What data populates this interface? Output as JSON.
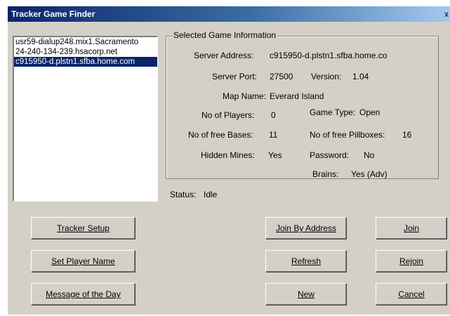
{
  "window": {
    "title": "Tracker Game Finder",
    "close_glyph": "x"
  },
  "servers": [
    "usr59-dialup248.mix1.Sacramento",
    "24-240-134-239.hsacorp.net",
    "c915950-d.plstn1.sfba.home.com"
  ],
  "selected_server_index": 2,
  "info": {
    "legend": "Selected Game Information",
    "server_address_label": "Server Address:",
    "server_address": "c915950-d.plstn1.sfba.home.co",
    "server_port_label": "Server Port:",
    "server_port": "27500",
    "version_label": "Version:",
    "version": "1.04",
    "map_name_label": "Map Name:",
    "map_name": "Everard Island",
    "players_label": "No of Players:",
    "players": "0",
    "game_type_label": "Game Type:",
    "game_type": "Open",
    "bases_label": "No of free Bases:",
    "bases": "11",
    "pillboxes_label": "No of free Pillboxes:",
    "pillboxes": "16",
    "mines_label": "Hidden Mines:",
    "mines": "Yes",
    "password_label": "Password:",
    "password": "No",
    "brains_label": "Brains:",
    "brains": "Yes (Adv)"
  },
  "status": {
    "label": "Status:",
    "value": "Idle"
  },
  "buttons": {
    "tracker_setup": "Tracker Setup",
    "set_player_name": "Set Player Name",
    "message_of_day": "Message of the Day",
    "join_by_address": "Join By Address",
    "refresh": "Refresh",
    "new": "New",
    "join": "Join",
    "rejoin": "Rejoin",
    "cancel": "Cancel"
  }
}
